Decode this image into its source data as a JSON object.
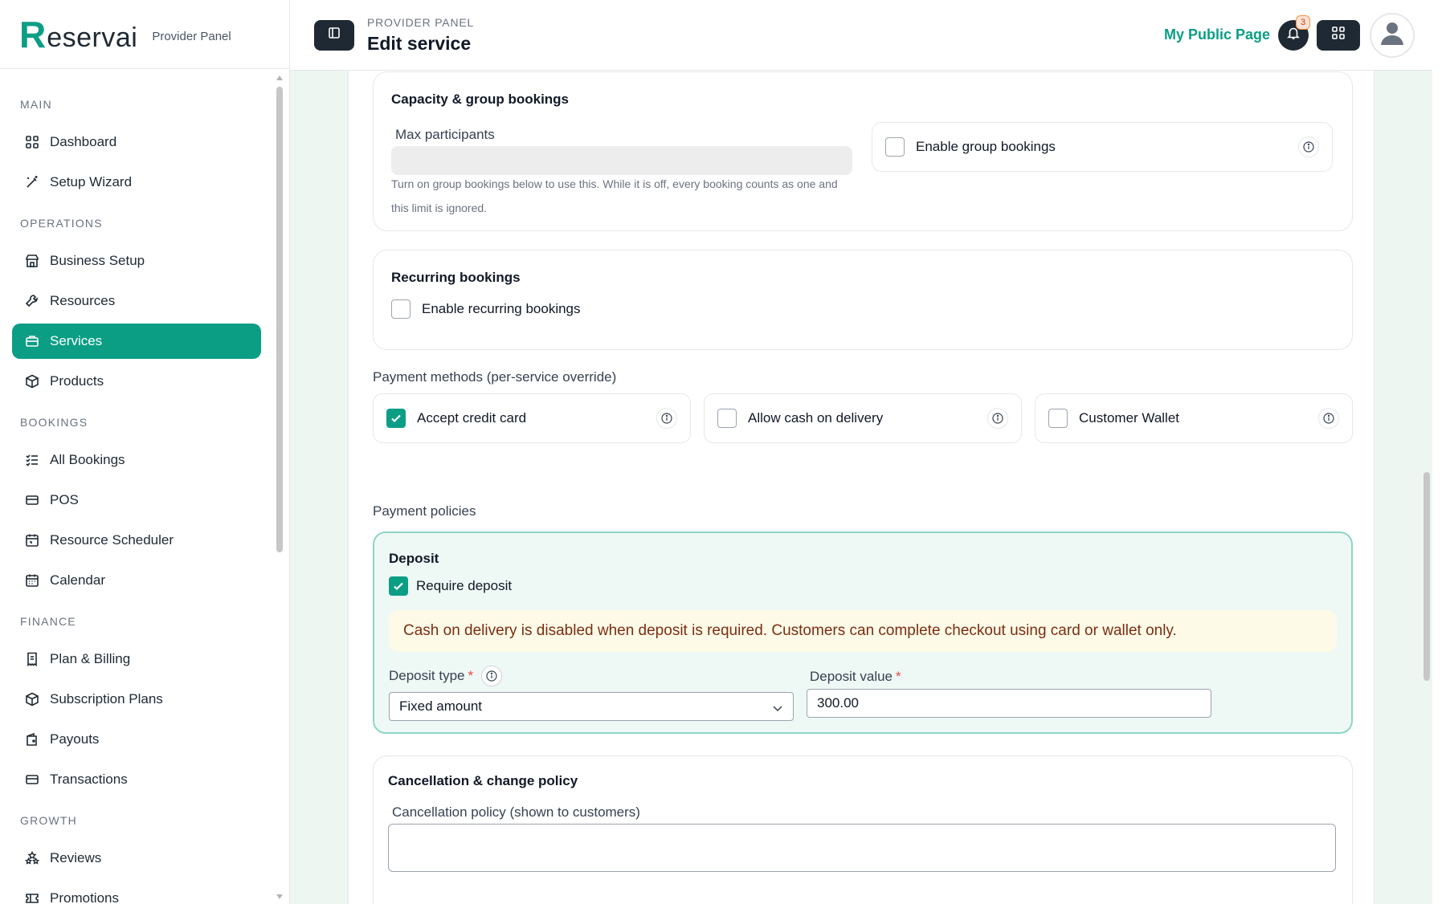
{
  "brand": {
    "name_r": "R",
    "name_rest": "eservai",
    "subtitle": "Provider Panel"
  },
  "sidebar": {
    "sections": {
      "main": "MAIN",
      "operations": "OPERATIONS",
      "bookings": "BOOKINGS",
      "finance": "FINANCE",
      "growth": "GROWTH"
    },
    "items": {
      "dashboard": "Dashboard",
      "setup_wizard": "Setup Wizard",
      "business_setup": "Business Setup",
      "resources": "Resources",
      "services": "Services",
      "products": "Products",
      "all_bookings": "All Bookings",
      "pos": "POS",
      "resource_scheduler": "Resource Scheduler",
      "calendar": "Calendar",
      "plan_billing": "Plan & Billing",
      "subscription_plans": "Subscription Plans",
      "payouts": "Payouts",
      "transactions": "Transactions",
      "reviews": "Reviews",
      "promotions": "Promotions"
    },
    "active": "services"
  },
  "header": {
    "crumb": "PROVIDER PANEL",
    "title": "Edit service",
    "public_page": "My Public Page",
    "notif_count": "3"
  },
  "capacity": {
    "title": "Capacity & group bookings",
    "max_label": "Max participants",
    "help": "Turn on group bookings below to use this. While it is off, every booking counts as one and this limit is ignored.",
    "group_label": "Enable group bookings",
    "group_checked": false
  },
  "recurring": {
    "title": "Recurring bookings",
    "enable_label": "Enable recurring bookings",
    "checked": false
  },
  "payment": {
    "methods_label": "Payment methods (per-service override)",
    "methods": [
      {
        "label": "Accept credit card",
        "checked": true
      },
      {
        "label": "Allow cash on delivery",
        "checked": false
      },
      {
        "label": "Customer Wallet",
        "checked": false
      }
    ],
    "policies_label": "Payment policies"
  },
  "deposit": {
    "title": "Deposit",
    "require_label": "Require deposit",
    "require_checked": true,
    "alert": "Cash on delivery is disabled when deposit is required. Customers can complete checkout using card or wallet only.",
    "type_label": "Deposit type",
    "type_value": "Fixed amount",
    "value_label": "Deposit value",
    "value": "300.00",
    "required_mark": "*"
  },
  "cancellation": {
    "title": "Cancellation & change policy",
    "policy_label": "Cancellation policy (shown to customers)"
  },
  "colors": {
    "accent": "#0b9e85",
    "dark": "#1f2933",
    "alert_text": "#7c2d12"
  }
}
